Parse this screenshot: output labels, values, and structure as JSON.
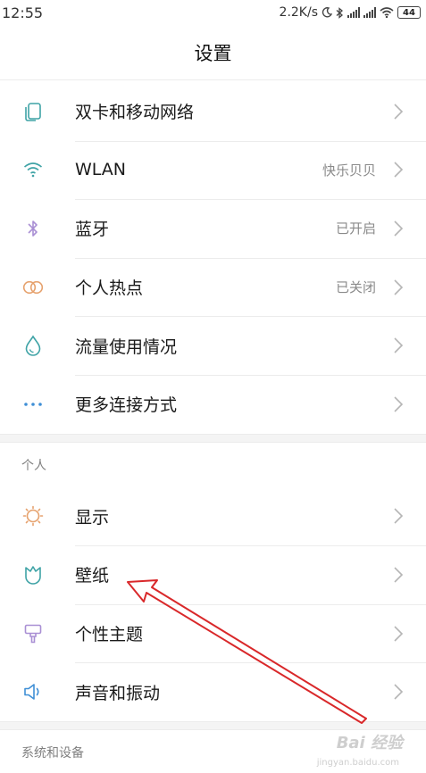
{
  "status_bar": {
    "time": "12:55",
    "speed": "2.2K/s",
    "battery": "44"
  },
  "header": {
    "title": "设置"
  },
  "connection_items": [
    {
      "label": "双卡和移动网络",
      "value": "",
      "icon": "sim-card-icon"
    },
    {
      "label": "WLAN",
      "value": "快乐贝贝",
      "icon": "wifi-icon"
    },
    {
      "label": "蓝牙",
      "value": "已开启",
      "icon": "bluetooth-icon"
    },
    {
      "label": "个人热点",
      "value": "已关闭",
      "icon": "hotspot-icon"
    },
    {
      "label": "流量使用情况",
      "value": "",
      "icon": "data-usage-icon"
    },
    {
      "label": "更多连接方式",
      "value": "",
      "icon": "more-connections-icon"
    }
  ],
  "personal_section": {
    "header": "个人",
    "items": [
      {
        "label": "显示",
        "icon": "display-sun-icon"
      },
      {
        "label": "壁纸",
        "icon": "wallpaper-icon"
      },
      {
        "label": "个性主题",
        "icon": "theme-brush-icon"
      },
      {
        "label": "声音和振动",
        "icon": "sound-icon"
      }
    ]
  },
  "system_section": {
    "header": "系统和设备"
  },
  "colors": {
    "sim": "#3fa3a6",
    "wifi": "#3fa3a6",
    "bluetooth": "#a98fd4",
    "hotspot": "#e6a26e",
    "data": "#3fa3a6",
    "more": "#3f8fd6",
    "display": "#e6a26e",
    "wallpaper": "#3fa3a6",
    "theme": "#a98fd4",
    "sound": "#3f8fd6",
    "annotation_arrow": "#d9282a"
  },
  "watermark": {
    "text": "Bai 经验",
    "sub": "jingyan.baidu.com"
  }
}
